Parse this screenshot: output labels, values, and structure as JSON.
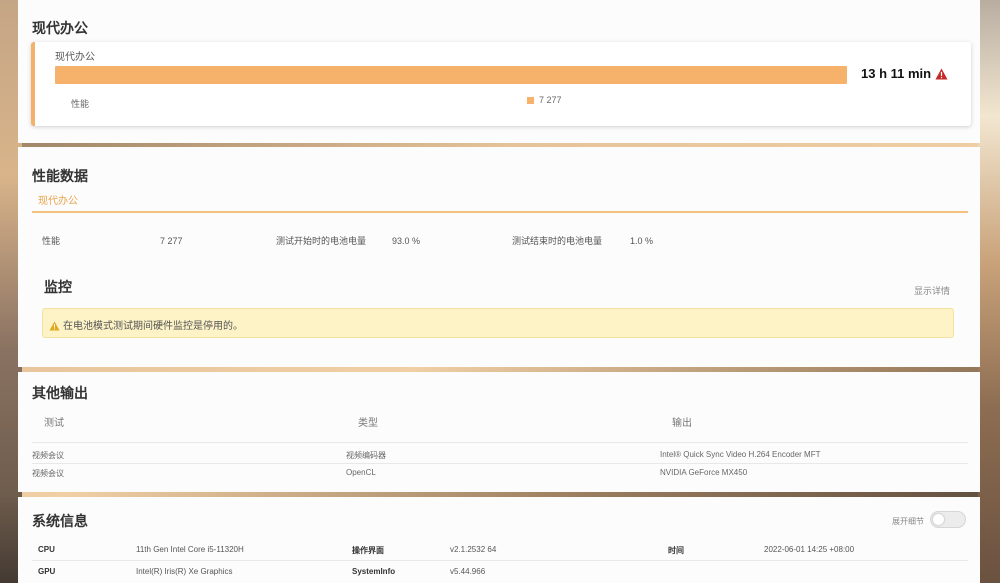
{
  "usage": {
    "section_title": "现代办公",
    "card_name": "现代办公",
    "time": "13 h 11 min",
    "perf_label": "性能",
    "perf_value": "7 277",
    "bar_color": "#f6b26b",
    "warn_icon": "warning-triangle-icon",
    "warn_color": "#c62828"
  },
  "performance": {
    "section_title": "性能数据",
    "tab_label": "现代办公",
    "metrics": [
      {
        "label": "性能",
        "value": "7 277"
      },
      {
        "label": "测试开始时的电池电量",
        "value": "93.0 %"
      },
      {
        "label": "测试结束时的电池电量",
        "value": "1.0 %"
      }
    ],
    "monitor_title": "监控",
    "monitor_link": "显示详情",
    "alert_text": "在电池模式测试期间硬件监控是停用的。",
    "alert_icon": "warning-triangle-icon"
  },
  "other_outputs": {
    "section_title": "其他输出",
    "columns": [
      "测试",
      "类型",
      "输出"
    ],
    "rows": [
      [
        "视频会议",
        "视频编码器",
        "Intel® Quick Sync Video H.264 Encoder MFT"
      ],
      [
        "视频会议",
        "OpenCL",
        "NVIDIA GeForce MX450"
      ]
    ]
  },
  "system_info": {
    "section_title": "系统信息",
    "toggle_label": "展开细节",
    "rows": [
      [
        {
          "k": "CPU",
          "v": "11th Gen Intel Core i5-11320H"
        },
        {
          "k": "操作界面",
          "v": "v2.1.2532 64"
        },
        {
          "k": "时间",
          "v": "2022-06-01 14:25 +08:00"
        }
      ],
      [
        {
          "k": "GPU",
          "v": "Intel(R) Iris(R) Xe Graphics"
        },
        {
          "k": "SystemInfo",
          "v": "v5.44.966"
        }
      ]
    ]
  },
  "accent_color": "#f2b26a"
}
